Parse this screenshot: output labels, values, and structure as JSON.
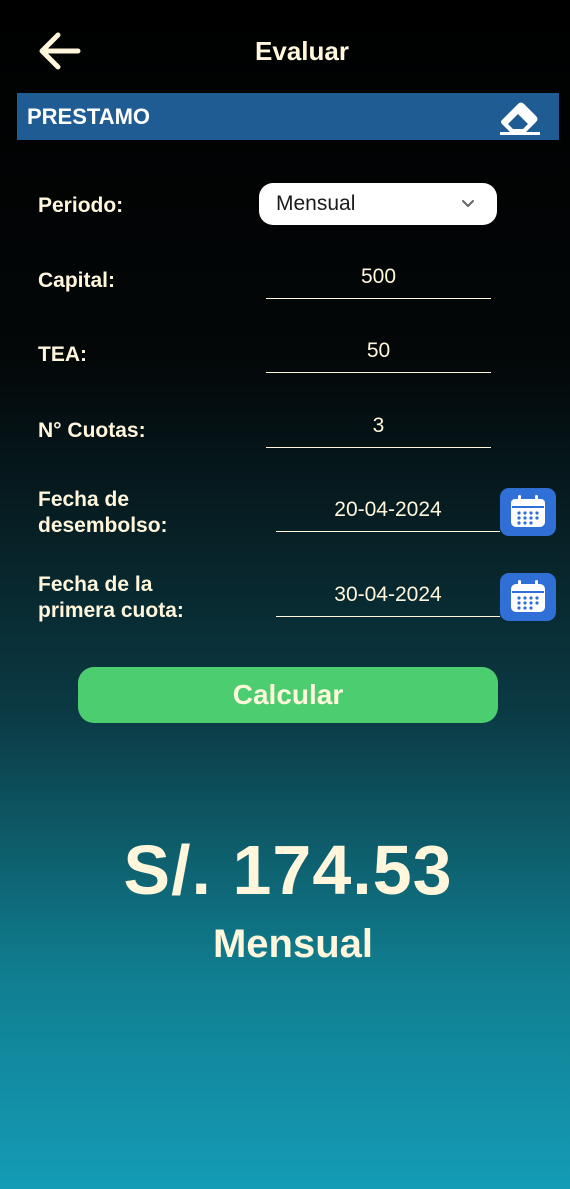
{
  "header": {
    "title": "Evaluar"
  },
  "section": {
    "title": "PRESTAMO"
  },
  "form": {
    "periodo": {
      "label": "Periodo:",
      "value": "Mensual"
    },
    "capital": {
      "label": "Capital:",
      "value": "500"
    },
    "tea": {
      "label": "TEA:",
      "value": "50"
    },
    "cuotas": {
      "label": "N° Cuotas:",
      "value": "3"
    },
    "fecha_desembolso": {
      "label_line1": "Fecha de",
      "label_line2": "desembolso:",
      "value": "20-04-2024"
    },
    "fecha_primera_cuota": {
      "label_line1": "Fecha de la",
      "label_line2": "primera cuota:",
      "value": "30-04-2024"
    }
  },
  "actions": {
    "calculate_label": "Calcular"
  },
  "result": {
    "amount": "S/. 174.53",
    "period": "Mensual"
  },
  "colors": {
    "section_bar": "#1f5c94",
    "calculate_button": "#4ccd6f",
    "calendar_button": "#2f6fd6",
    "text": "#fff6dc"
  },
  "icons": {
    "back": "arrow-left-icon",
    "clear": "eraser-icon",
    "dropdown": "chevron-down-icon",
    "calendar": "calendar-icon"
  }
}
